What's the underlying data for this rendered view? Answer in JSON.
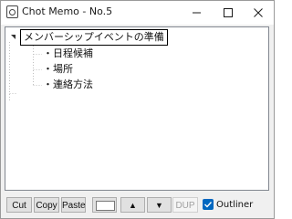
{
  "window": {
    "title": "Chot Memo - No.5"
  },
  "tree": {
    "root": {
      "label": "メンバーシップイベントの準備",
      "expanded": true
    },
    "children": [
      {
        "label": "・日程候補"
      },
      {
        "label": "・場所"
      },
      {
        "label": "・連絡方法"
      }
    ]
  },
  "toolbar": {
    "cut_label": "Cut",
    "copy_label": "Copy",
    "paste_label": "Paste",
    "color_value": "#ffffff",
    "up_icon": "▲",
    "down_icon": "▼",
    "dup_label": "DUP",
    "dup_enabled": false,
    "outliner_label": "Outliner",
    "outliner_checked": true
  },
  "colors": {
    "accent": "#0067c0",
    "button_face": "#e1e1e1",
    "window_bg": "#f0f0f0"
  }
}
